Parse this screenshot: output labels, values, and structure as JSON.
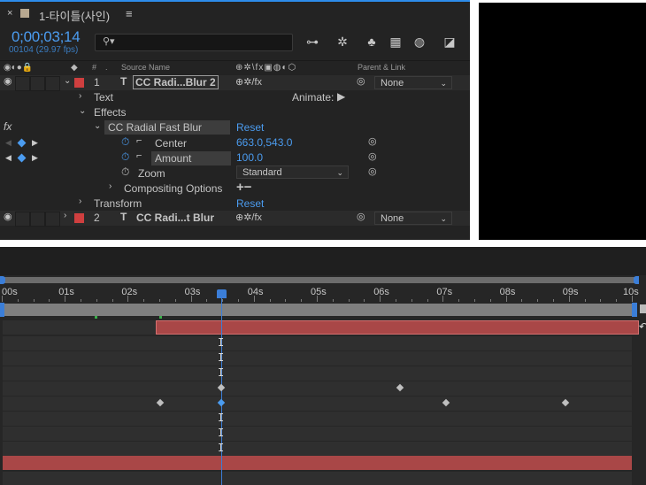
{
  "composition": {
    "tab_title": "1-타이틀(사인)"
  },
  "timecode": "0;00;03;14",
  "frame_info": "00104 (29.97 fps)",
  "search": {
    "placeholder": ""
  },
  "columns": {
    "hash": "#",
    "source_name": "Source Name",
    "parent_link": "Parent & Link"
  },
  "layers": [
    {
      "number": "1",
      "type": "T",
      "name": "CC Radi...Blur 2",
      "parent": "None",
      "color": "#cf3f3f"
    },
    {
      "number": "2",
      "type": "T",
      "name": "CC Radi...t Blur",
      "parent": "None",
      "color": "#cf3f3f"
    }
  ],
  "properties": {
    "text": "Text",
    "animate_label": "Animate:",
    "effects": "Effects",
    "effect_name": "CC Radial Fast Blur",
    "reset": "Reset",
    "fx": "fx",
    "center_label": "Center",
    "center_value": "663.0,543.0",
    "amount_label": "Amount",
    "amount_value": "100.0",
    "zoom_label": "Zoom",
    "zoom_value": "Standard",
    "compositing": "Compositing Options",
    "compositing_ops": "+−",
    "transform": "Transform",
    "transform_reset": "Reset"
  },
  "ruler": [
    "00s",
    "01s",
    "02s",
    "03s",
    "04s",
    "05s",
    "06s",
    "07s",
    "08s",
    "09s",
    "10s"
  ],
  "playhead_time_s": 3.5,
  "colors": {
    "accent": "#4b9cf0",
    "layer_label": "#cf3f3f",
    "layer_bar": "#a94747"
  }
}
